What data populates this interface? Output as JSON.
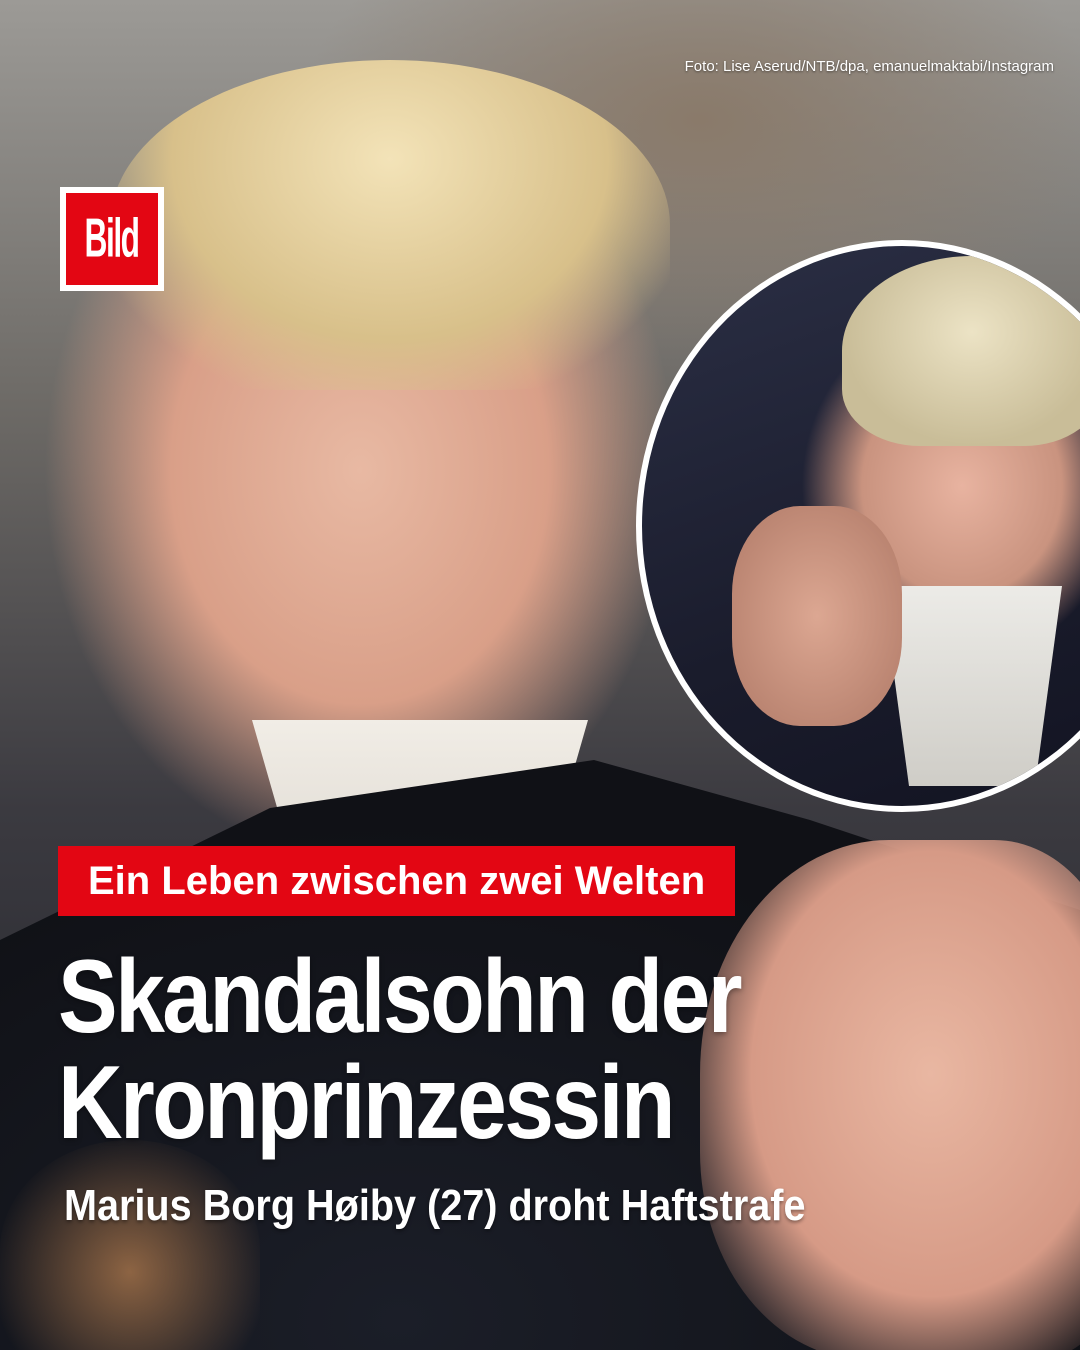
{
  "credit": "Foto: Lise Aserud/NTB/dpa, emanuelmaktabi/Instagram",
  "logo": "Bild",
  "kicker": "Ein Leben zwischen zwei Welten",
  "headline": {
    "line1": "Skandalsohn der",
    "line2": "Kronprinzessin"
  },
  "subheadline": "Marius Borg Høiby (27) droht Haftstrafe",
  "colors": {
    "brand_red": "#e30613",
    "text": "#ffffff"
  }
}
